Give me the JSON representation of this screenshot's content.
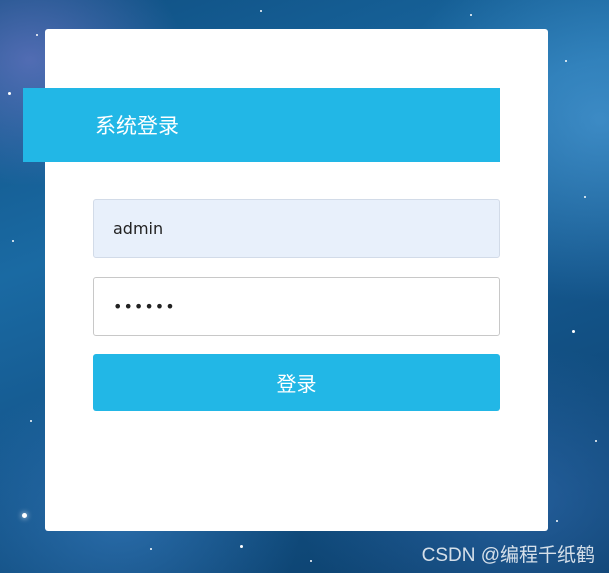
{
  "login": {
    "title": "系统登录",
    "username_value": "admin",
    "password_value": "••••••",
    "submit_label": "登录"
  },
  "watermark": {
    "text": "CSDN @编程千纸鹤"
  },
  "colors": {
    "accent": "#22b7e6",
    "card_background": "#ffffff",
    "username_autofill_background": "#e8f0fb"
  }
}
